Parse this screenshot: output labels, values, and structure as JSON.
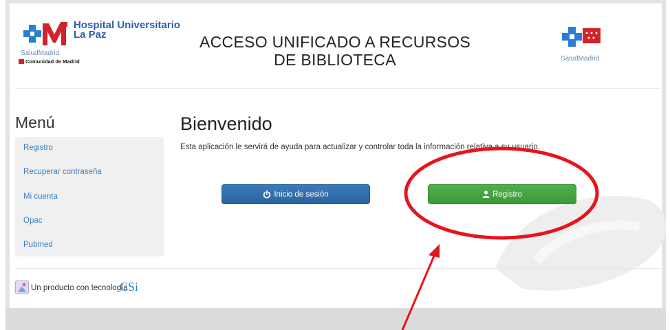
{
  "header": {
    "hospital_line1": "Hospital Universitario",
    "hospital_line2": "La Paz",
    "salud_madrid": "SaludMadrid",
    "comunidad": "Comunidad de Madrid",
    "title_line1": "ACCESO UNIFICADO A RECURSOS",
    "title_line2": "DE BIBLIOTECA",
    "salud_madrid_right": "SaludMadrid"
  },
  "sidebar": {
    "title": "Menú",
    "items": [
      {
        "label": "Registro"
      },
      {
        "label": "Recuperar contraseña"
      },
      {
        "label": "Mi cuenta"
      },
      {
        "label": "Opac"
      },
      {
        "label": "Pubmed"
      }
    ]
  },
  "main": {
    "heading": "Bienvenido",
    "description": "Esta aplicación le servirá de ayuda para actualizar y controlar toda la información relativa a su usuario.",
    "login_label": "Inicio de sesión",
    "register_label": "Registro"
  },
  "footer": {
    "text": "Un producto con tecnología",
    "brand": "CSi"
  },
  "colors": {
    "primary_blue": "#2b659f",
    "success_green": "#3c9a37",
    "link_blue": "#3a80c4",
    "annotation_red": "#e8141b"
  },
  "icons": {
    "login": "power-icon",
    "register": "user-icon"
  }
}
